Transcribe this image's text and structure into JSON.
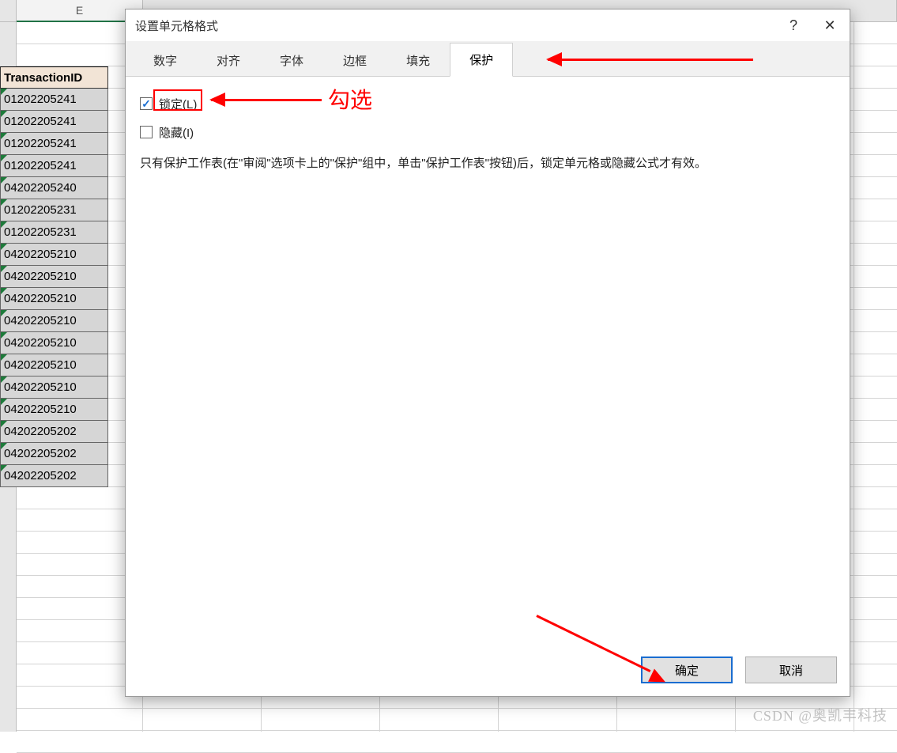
{
  "sheet": {
    "selected_col_letter": "E",
    "header_cell": "TransactionID",
    "data_values": [
      "01202205241",
      "01202205241",
      "01202205241",
      "01202205241",
      "04202205240",
      "01202205231",
      "01202205231",
      "04202205210",
      "04202205210",
      "04202205210",
      "04202205210",
      "04202205210",
      "04202205210",
      "04202205210",
      "04202205210",
      "04202205202",
      "04202205202",
      "04202205202"
    ]
  },
  "dialog": {
    "title": "设置单元格格式",
    "help_label": "?",
    "close_label": "✕",
    "tabs": [
      "数字",
      "对齐",
      "字体",
      "边框",
      "填充",
      "保护"
    ],
    "active_tab_index": 5,
    "checkbox_locked_label": "锁定(L)",
    "checkbox_locked_checked": true,
    "checkbox_hidden_label": "隐藏(I)",
    "checkbox_hidden_checked": false,
    "help_text": "只有保护工作表(在\"审阅\"选项卡上的\"保护\"组中，单击\"保护工作表\"按钮)后，锁定单元格或隐藏公式才有效。",
    "ok_label": "确定",
    "cancel_label": "取消"
  },
  "annotation": {
    "check_label": "勾选"
  },
  "watermark": "CSDN @奥凯丰科技"
}
